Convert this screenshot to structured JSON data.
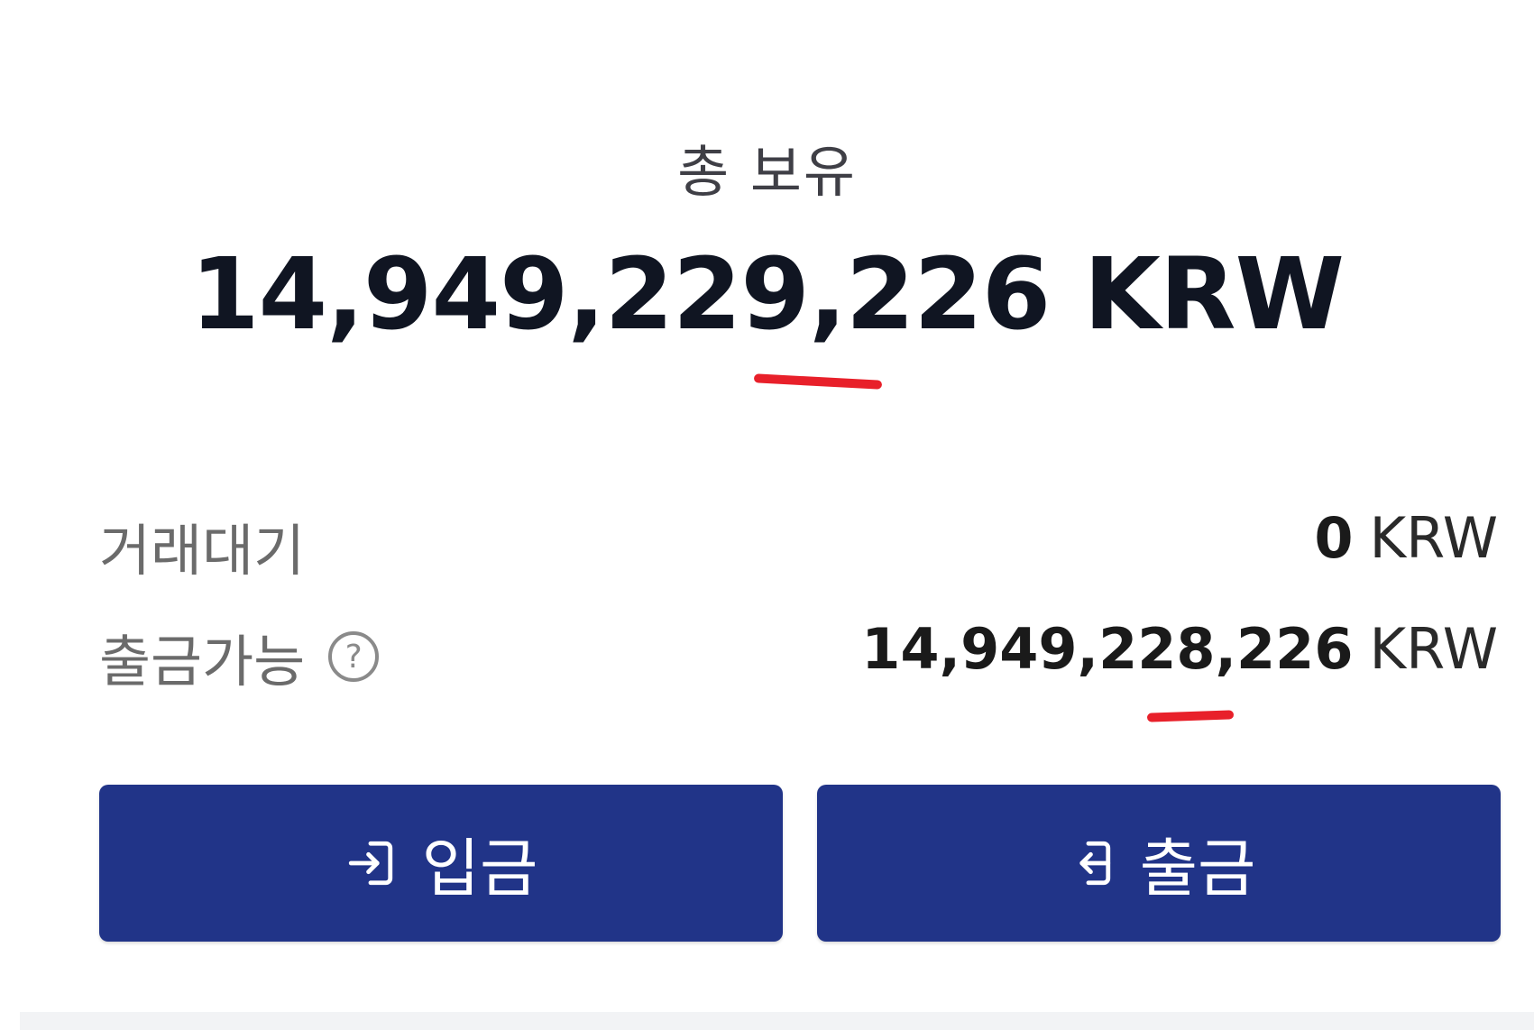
{
  "summary": {
    "total_label": "총 보유",
    "total_amount": "14,949,229,226 KRW"
  },
  "balances": {
    "pending": {
      "label": "거래대기",
      "amount": "0",
      "currency": "KRW"
    },
    "withdrawable": {
      "label": "출금가능",
      "help_icon": "question-circle-icon",
      "amount": "14,949,228,226",
      "currency": "KRW"
    }
  },
  "actions": {
    "deposit_label": "입금",
    "deposit_icon": "deposit-arrow-icon",
    "withdraw_label": "출금",
    "withdraw_icon": "withdraw-arrow-icon"
  },
  "colors": {
    "button_bg": "#213488",
    "annotation": "#e8202a"
  }
}
